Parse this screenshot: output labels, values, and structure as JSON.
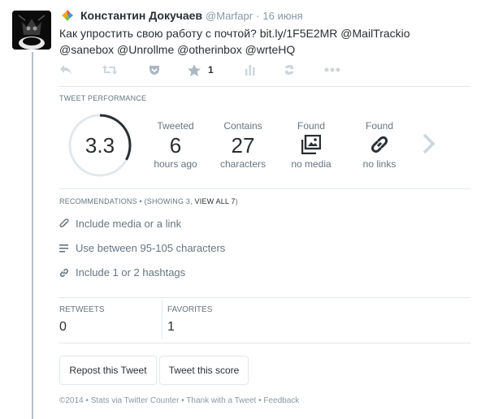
{
  "tweet": {
    "author_name": "Константин Докучаев",
    "handle": "@Marfapr",
    "separator": "·",
    "date": "16 июня",
    "text_plain": "Как упростить свою работу с почтой? ",
    "link": "bit.ly/1F5E2MR",
    "mentions_line1": " @MailTrackio",
    "mentions_line2": "@sanebox @Unrollme @otherinbox @wrteHQ",
    "favorite_count": "1"
  },
  "icons": {
    "app": "app-logo-icon",
    "reply": "reply-icon",
    "retweet": "retweet-icon",
    "pocket": "pocket-icon",
    "favorite": "star-icon",
    "analytics": "bar-chart-icon",
    "buffer": "buffer-icon",
    "more": "ellipsis-icon",
    "media": "image-icon",
    "links": "link-icon",
    "next": "chevron-right-icon"
  },
  "performance": {
    "label": "TWEET PERFORMANCE",
    "score": "3.3",
    "score_max": 10,
    "stats": [
      {
        "top": "Tweeted",
        "big": "6",
        "bottom": "hours ago"
      },
      {
        "top": "Contains",
        "big": "27",
        "bottom": "characters"
      },
      {
        "top": "Found",
        "bottom": "no media"
      },
      {
        "top": "Found",
        "bottom": "no links"
      }
    ]
  },
  "recommendations": {
    "label": "RECOMMENDATIONS",
    "count_prefix": " • (SHOWING 3, ",
    "view_all": "VIEW ALL 7",
    "count_suffix": ")",
    "items": [
      {
        "icon": "paperclip-icon",
        "text": "Include media or a link"
      },
      {
        "icon": "text-lines-icon",
        "text": "Use between 95-105 characters"
      },
      {
        "icon": "link-icon",
        "text": "Include 1 or 2 hashtags"
      }
    ]
  },
  "counters": {
    "retweets_label": "RETWEETS",
    "retweets_value": "0",
    "favorites_label": "FAVORITES",
    "favorites_value": "1"
  },
  "buttons": {
    "repost": "Repost this Tweet",
    "tweet_score": "Tweet this score"
  },
  "footer": {
    "copyright": "©2014",
    "sep": " • ",
    "stats_via": "Stats via Twitter Counter",
    "thank": "Thank with a Tweet",
    "feedback": "Feedback"
  },
  "colors": {
    "ring_active": "#292f33",
    "ring_track": "#e1e8ed",
    "icon_gray": "#aab8c2",
    "text_dark": "#292f33",
    "text_gray": "#66757f"
  }
}
